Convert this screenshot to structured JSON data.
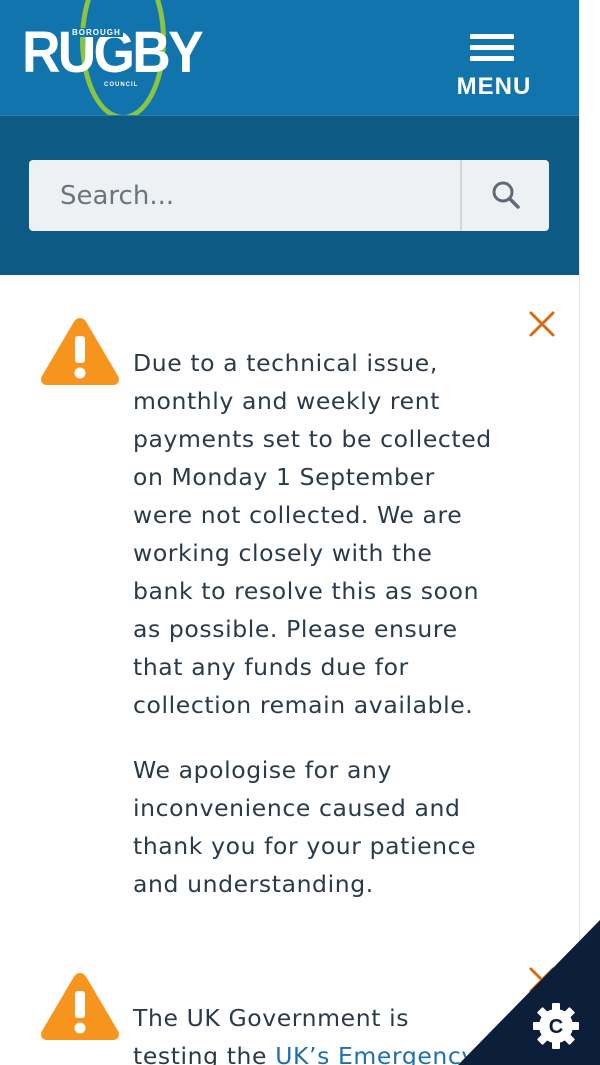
{
  "header": {
    "logo_main": "RUGBY",
    "logo_top": "BOROUGH",
    "logo_bottom": "COUNCIL",
    "menu_label": "MENU"
  },
  "search": {
    "placeholder": "Search...",
    "value": ""
  },
  "alerts": [
    {
      "paragraph_1": "Due to a technical issue, monthly and weekly rent payments set to be collected on Monday 1 September were not collected. We are working closely with the bank to resolve this as soon as possible. Please ensure that any funds due for collection remain available.",
      "paragraph_2": "We apologise for any inconvenience caused and thank you for your patience and understanding."
    },
    {
      "text_before_link": "The UK Government is testing the ",
      "link_text": "UK’s Emergency"
    }
  ],
  "colors": {
    "header_blue": "#1274ad",
    "search_band": "#0d5a84",
    "logo_ring_green": "#8bc53f",
    "warning_orange": "#f7941d",
    "close_orange": "#d86a12",
    "text_dark": "#2b3a4a",
    "link_blue": "#1e6fb0",
    "cookie_corner": "#0b1e3a"
  },
  "icons": [
    "menu-icon",
    "search-icon",
    "warning-icon",
    "close-icon",
    "cookie-icon"
  ]
}
